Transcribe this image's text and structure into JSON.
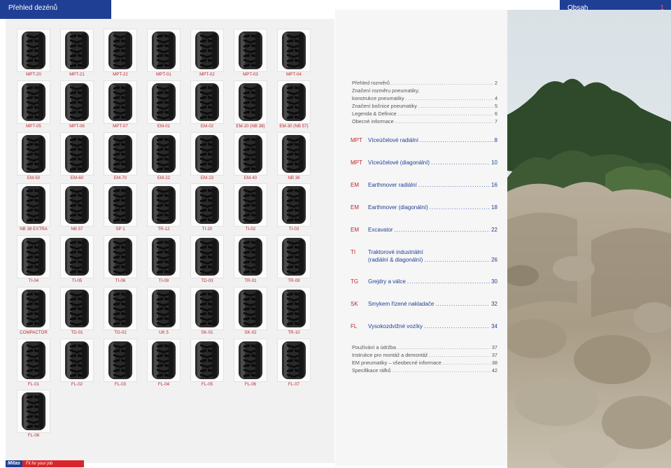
{
  "header": {
    "left_title": "Přehled dezénů",
    "right_title": "Obsah",
    "page_number": "1"
  },
  "tires": [
    "MPT-20",
    "MPT-21",
    "MPT-22",
    "MPT-01",
    "MPT-02",
    "MPT-03",
    "MPT-04",
    "MPT-05",
    "MPT-06",
    "MPT-07",
    "EM-01",
    "EM-02",
    "EM-20 (NB 38)",
    "EM-30 (NB 57)",
    "EM-50",
    "EM-60",
    "EM-70",
    "EM-22",
    "EM-23",
    "EM-40",
    "NB 38",
    "NB 38 EXTRA",
    "NB 57",
    "SP 1",
    "TR-12",
    "TI-20",
    "TI-02",
    "TI-03",
    "TI-04",
    "TI-05",
    "TI-06",
    "TI-09",
    "TD-03",
    "TR-01",
    "TR-09",
    "COMPACTOR",
    "TD-01",
    "TG-02",
    "UK 5",
    "SK-01",
    "SK-02",
    "TR-10",
    "FL-01",
    "FL-02",
    "FL-03",
    "FL-04",
    "FL-05",
    "FL-06",
    "FL-07",
    "FL-08"
  ],
  "toc_intro": [
    {
      "title": "Přehled rozměrů",
      "page": "2"
    },
    {
      "title": "Značení rozměru pneumatiky;",
      "page": ""
    },
    {
      "title": "konstrukce pneumatiky",
      "page": "4"
    },
    {
      "title": "Značení bočnice pneumatiky",
      "page": "5"
    },
    {
      "title": "Legenda & Definice",
      "page": "6"
    },
    {
      "title": "Obecné informace",
      "page": "7"
    }
  ],
  "toc_sections": [
    {
      "code": "MPT",
      "title": "Víceúčelové radiální",
      "page": "8"
    },
    {
      "code": "MPT",
      "title": "Víceúčelové (diagonální)",
      "page": "10"
    },
    {
      "code": "EM",
      "title": "Earthmover radiální",
      "page": "16"
    },
    {
      "code": "EM",
      "title": "Earthmover (diagonální)",
      "page": "18"
    },
    {
      "code": "EM",
      "title": "Excavator",
      "page": "22"
    },
    {
      "code": "TI",
      "title": "Traktorové industriální",
      "title2": "(radiální & diagonální)",
      "page": "26"
    },
    {
      "code": "TG",
      "title": "Grejdry a válce",
      "page": "30"
    },
    {
      "code": "SK",
      "title": "Smykem řízené nakladače",
      "page": "32"
    },
    {
      "code": "FL",
      "title": "Vysokozdvižné vozíky",
      "page": "34"
    }
  ],
  "toc_appendix": [
    {
      "title": "Používání a údržba",
      "page": "37"
    },
    {
      "title": "Instrukce pro montáž a demontáž",
      "page": "37"
    },
    {
      "title": "EM pneumatiky – všeobecné informace",
      "page": "38"
    },
    {
      "title": "Specifikace ráfků",
      "page": "42"
    }
  ],
  "logo": {
    "brand": "Mitas",
    "slogan": "Fit for your job"
  },
  "colors": {
    "brand_blue": "#1f3f95",
    "accent_red": "#c0262d"
  }
}
